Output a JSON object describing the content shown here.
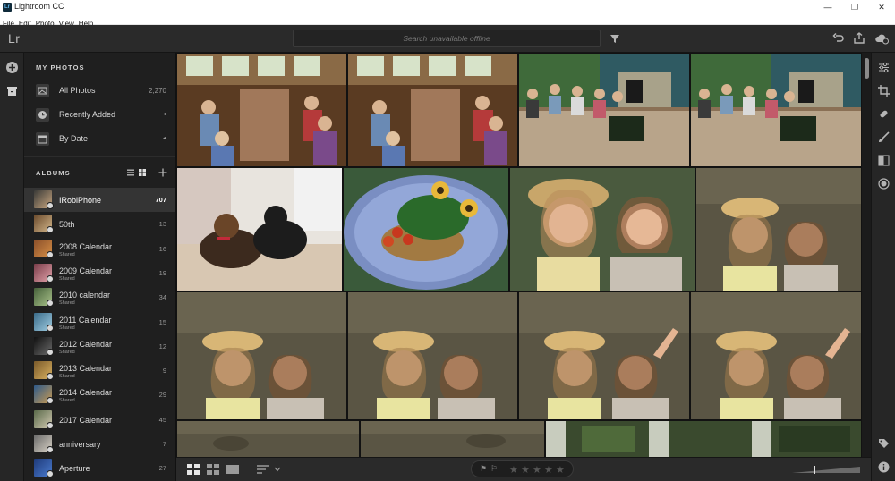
{
  "window": {
    "title": "Lightroom CC",
    "app_icon": "Lr"
  },
  "menu": [
    "File",
    "Edit",
    "Photo",
    "View",
    "Help"
  ],
  "toolbar": {
    "logo": "Lr",
    "search_placeholder": "Search unavailable offline"
  },
  "sidebar": {
    "my_photos_title": "MY PHOTOS",
    "photos": [
      {
        "label": "All Photos",
        "count": "2,270",
        "icon": "all-photos-icon"
      },
      {
        "label": "Recently Added",
        "arrow": "◂",
        "icon": "clock-icon"
      },
      {
        "label": "By Date",
        "arrow": "◂",
        "icon": "calendar-icon"
      }
    ],
    "albums_title": "ALBUMS",
    "albums": [
      {
        "label": "IRobiPhone",
        "sub": "",
        "count": "707",
        "active": true,
        "thumb": [
          "#3a3a38",
          "#c7a57f"
        ]
      },
      {
        "label": "50th",
        "sub": "",
        "count": "13",
        "thumb": [
          "#6a4a2c",
          "#d3b68a"
        ]
      },
      {
        "label": "2008 Calendar",
        "sub": "Shared",
        "count": "16",
        "thumb": [
          "#8a4f2a",
          "#d68f46"
        ]
      },
      {
        "label": "2009 Calendar",
        "sub": "Shared",
        "count": "19",
        "thumb": [
          "#7a3d4a",
          "#e0a0a8"
        ]
      },
      {
        "label": "2010 calendar",
        "sub": "Shared",
        "count": "34",
        "thumb": [
          "#45603a",
          "#a9c28a"
        ]
      },
      {
        "label": "2011 Calendar",
        "sub": "Shared",
        "count": "15",
        "thumb": [
          "#3b6c8a",
          "#9ecbe0"
        ]
      },
      {
        "label": "2012 Calendar",
        "sub": "Shared",
        "count": "12",
        "thumb": [
          "#111111",
          "#6a6a6a"
        ]
      },
      {
        "label": "2013 Calendar",
        "sub": "Shared",
        "count": "9",
        "thumb": [
          "#7a5a2a",
          "#d8b060"
        ]
      },
      {
        "label": "2014 Calendar",
        "sub": "Shared",
        "count": "29",
        "thumb": [
          "#2e5a8a",
          "#c89a52"
        ]
      },
      {
        "label": "2017 Calendar",
        "sub": "",
        "count": "45",
        "thumb": [
          "#5a6a4a",
          "#d0c8b0"
        ]
      },
      {
        "label": "anniversary",
        "sub": "",
        "count": "7",
        "thumb": [
          "#6a6a6a",
          "#d6d0c4"
        ]
      },
      {
        "label": "Aperture",
        "sub": "",
        "count": "27",
        "thumb": [
          "#1e3a7a",
          "#4a7acc"
        ]
      }
    ]
  },
  "bottombar": {
    "stars": [
      "★",
      "★",
      "★",
      "★",
      "★"
    ],
    "flags": [
      "⚑",
      "⚐"
    ]
  },
  "colors": {
    "panel": "#1f1f1f",
    "toolbar": "#2a2a2a",
    "active_album": "#343434",
    "grid_bg": "#121212"
  }
}
